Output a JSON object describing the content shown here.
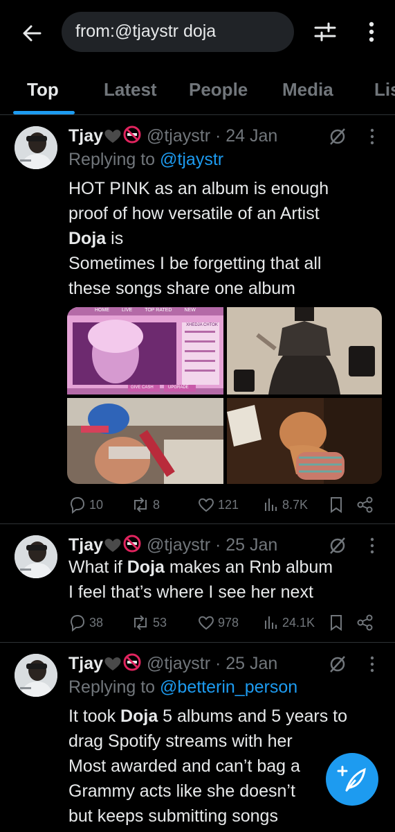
{
  "search": {
    "query": "from:@tjaystr doja"
  },
  "tabs": [
    "Top",
    "Latest",
    "People",
    "Media",
    "Lis"
  ],
  "colors": {
    "accent": "#1d9bf0",
    "background": "#000000",
    "text": "#e7e9ea",
    "muted": "#71767b"
  },
  "tweets": [
    {
      "name": "Tjay",
      "handle": "@tjaystr",
      "date": "· 24 Jan",
      "reply_prefix": "Replying to",
      "reply_to": "@tjaystr",
      "lines": [
        "HOT PINK as an album is enough",
        "proof of how versatile of an Artist",
        "Doja is",
        "Sometimes I be forgetting that all",
        "these songs share one album"
      ],
      "media_top_bar": [
        "HOME",
        "LIVE",
        "TOP RATED",
        "NEW"
      ],
      "media_chat_title": "XHEDJA CHTOK",
      "media_buttons": [
        "GIVE CASH",
        "UPGRADE"
      ],
      "replies": "10",
      "reposts": "8",
      "likes": "121",
      "views": "8.7K"
    },
    {
      "name": "Tjay",
      "handle": "@tjaystr",
      "date": "· 25 Jan",
      "lines": [
        "What if Doja makes an Rnb album",
        "I feel that’s where I see her next"
      ],
      "replies": "38",
      "reposts": "53",
      "likes": "978",
      "views": "24.1K"
    },
    {
      "name": "Tjay",
      "handle": "@tjaystr",
      "date": "· 25 Jan",
      "reply_prefix": "Replying to",
      "reply_to": "@betterin_person",
      "lines": [
        "It took Doja 5 albums and 5 years to",
        "drag Spotify streams with her",
        "Most awarded and can’t bag a",
        "Grammy acts like she doesn’t",
        "but keeps submitting songs"
      ]
    }
  ],
  "icons": {
    "back": "arrow-left-icon",
    "filter": "sliders-icon",
    "more": "vertical-dots-icon",
    "grok": "grok-icon",
    "reply": "reply-icon",
    "repost": "repost-icon",
    "like": "heart-icon",
    "views": "views-icon",
    "bookmark": "bookmark-icon",
    "share": "share-icon",
    "compose": "compose-feather-icon"
  }
}
